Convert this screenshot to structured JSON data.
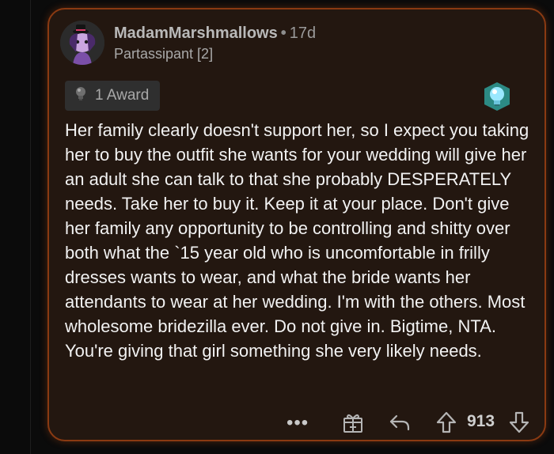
{
  "comment": {
    "author": "MadamMarshmallows",
    "separator": "•",
    "age": "17d",
    "flair": "Partassipant [2]",
    "award_label": "1 Award",
    "body": "Her family clearly doesn't support her, so I expect you taking her to buy the outfit she wants for your wedding will give her an adult she can talk to that she probably DESPERATELY needs. Take her to buy it. Keep it at your place. Don't give her family any opportunity to be controlling and shitty over both what the `15 year old who is uncomfortable in frilly dresses wants to wear, and what the bride wants her attendants to wear at her wedding. I'm with the others. Most wholesome bridezilla ever. Do not give in. Bigtime, NTA. You're giving that girl something she very likely needs.",
    "more_label": "•••",
    "score": "913"
  },
  "colors": {
    "card_border": "#8a3a12",
    "card_bg": "#231710",
    "text": "#f2f2f2",
    "meta": "#b9b9b9"
  },
  "icons": [
    "avatar",
    "award-bulb-icon",
    "award-badge-icon",
    "more-icon",
    "gift-icon",
    "reply-icon",
    "upvote-icon",
    "downvote-icon"
  ]
}
